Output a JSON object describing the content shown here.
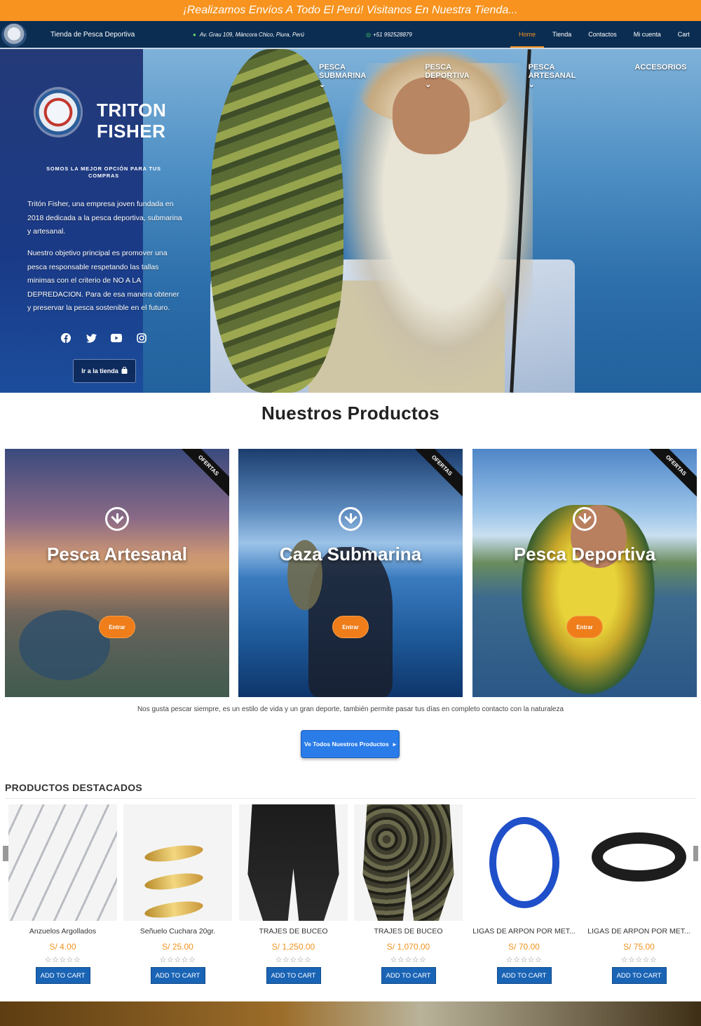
{
  "topbar": {
    "text": "¡Realizamos Envíos A Todo El Perú! Visitanos En Nuestra Tienda..."
  },
  "navbar": {
    "store_name": "Tienda de Pesca Deportiva",
    "address": "Av. Grau 109, Máncora Chico, Piura, Perú",
    "phone": "+51 992528879",
    "menu": [
      "Home",
      "Tienda",
      "Contactos",
      "Mi cuenta",
      "Cart"
    ],
    "active": "Home"
  },
  "hero": {
    "menu": [
      "PESCA SUBMARINA",
      "PESCA DEPORTIVA",
      "PESCA ARTESANAL",
      "ACCESORIOS"
    ],
    "brand_line1": "TRITON",
    "brand_line2": "FISHER",
    "tagline": "SOMOS LA MEJOR OPCIÓN PARA TUS COMPRAS",
    "paragraph1": "Tritón Fisher, una empresa  joven fundada en 2018 dedicada a la pesca deportiva, submarina y artesanal.",
    "paragraph2": "Nuestro objetivo principal  es promover una pesca responsable respetando las tallas minimas con el criterio de NO A LA DEPREDACION. Para de esa manera obtener y preservar  la pesca sostenible en el futuro.",
    "socials": [
      "facebook-icon",
      "twitter-icon",
      "youtube-icon",
      "instagram-icon"
    ],
    "shop_button": "Ir a la tienda"
  },
  "products_section": {
    "title": "Nuestros Productos",
    "categories": [
      {
        "title": "Pesca Artesanal",
        "ribbon": "OFERTAS",
        "button": "Entrar"
      },
      {
        "title": "Caza Submarina",
        "ribbon": "OFERTAS",
        "button": "Entrar"
      },
      {
        "title": "Pesca Deportiva",
        "ribbon": "OFERTAS",
        "button": "Entrar"
      }
    ],
    "tagline": "Nos gusta pescar siempre, es un estilo de vida y un gran deporte, también permite pasar tus días en completo contacto con la naturaleza",
    "all_button": "Ve Todos Nuestros Productos"
  },
  "featured": {
    "title": "PRODUCTOS DESTACADOS",
    "cart_label": "ADD TO CART",
    "items": [
      {
        "name": "Anzuelos Argollados",
        "price": "S/ 4.00",
        "rating": "☆☆☆☆☆"
      },
      {
        "name": "Señuelo Cuchara 20gr.",
        "price": "S/ 25.00",
        "rating": "☆☆☆☆☆"
      },
      {
        "name": "TRAJES DE BUCEO",
        "price": "S/ 1,250.00",
        "rating": "☆☆☆☆☆"
      },
      {
        "name": "TRAJES DE BUCEO",
        "price": "S/ 1,070.00",
        "rating": "☆☆☆☆☆"
      },
      {
        "name": "LIGAS DE ARPON POR MET...",
        "price": "S/ 70.00",
        "rating": "☆☆☆☆☆"
      },
      {
        "name": "LIGAS DE ARPON POR MET...",
        "price": "S/ 75.00",
        "rating": "☆☆☆☆☆"
      }
    ]
  },
  "colors": {
    "accent": "#f7931e",
    "nav": "#0b2d52",
    "button_blue": "#2a7ce8",
    "cart_blue": "#1a64b5"
  }
}
